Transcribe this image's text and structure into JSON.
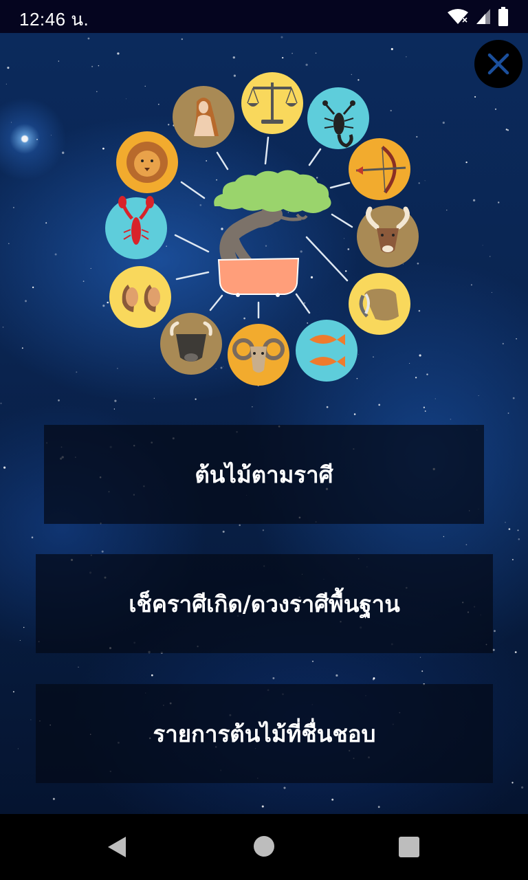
{
  "status_bar": {
    "time": "12:46 น.",
    "icons": [
      "wifi-icon",
      "cell-signal-icon",
      "battery-icon"
    ]
  },
  "close_button": {
    "icon": "close-icon"
  },
  "illustration": {
    "center": "bonsai-tree-icon",
    "signs": [
      "libra-scales-icon",
      "scorpio-scorpion-icon",
      "sagittarius-bow-icon",
      "capricorn-goat-icon",
      "aquarius-jar-icon",
      "pisces-fish-icon",
      "aries-ram-icon",
      "taurus-bull-icon",
      "gemini-twins-icon",
      "cancer-lobster-icon",
      "leo-lion-icon",
      "virgo-maiden-icon"
    ]
  },
  "menu": {
    "tree_by_zodiac": "ต้นไม้ตามราศี",
    "check_birth_sign": "เช็คราศีเกิด/ดวงราศีพื้นฐาน",
    "favorite_trees": "รายการต้นไม้ที่ชื่นชอบ"
  },
  "nav_bar": {
    "back": "back-icon",
    "home": "home-icon",
    "recents": "recents-icon"
  },
  "colors": {
    "background": "#0a2450",
    "button_bg": "#040a18",
    "yellow_circle": "#f9d85c",
    "orange_circle": "#f2ab2e",
    "cyan_circle": "#5ecddb",
    "brown_circle": "#a98a55",
    "tree_foliage": "#9ad46c",
    "pot": "#ff9e7a"
  }
}
